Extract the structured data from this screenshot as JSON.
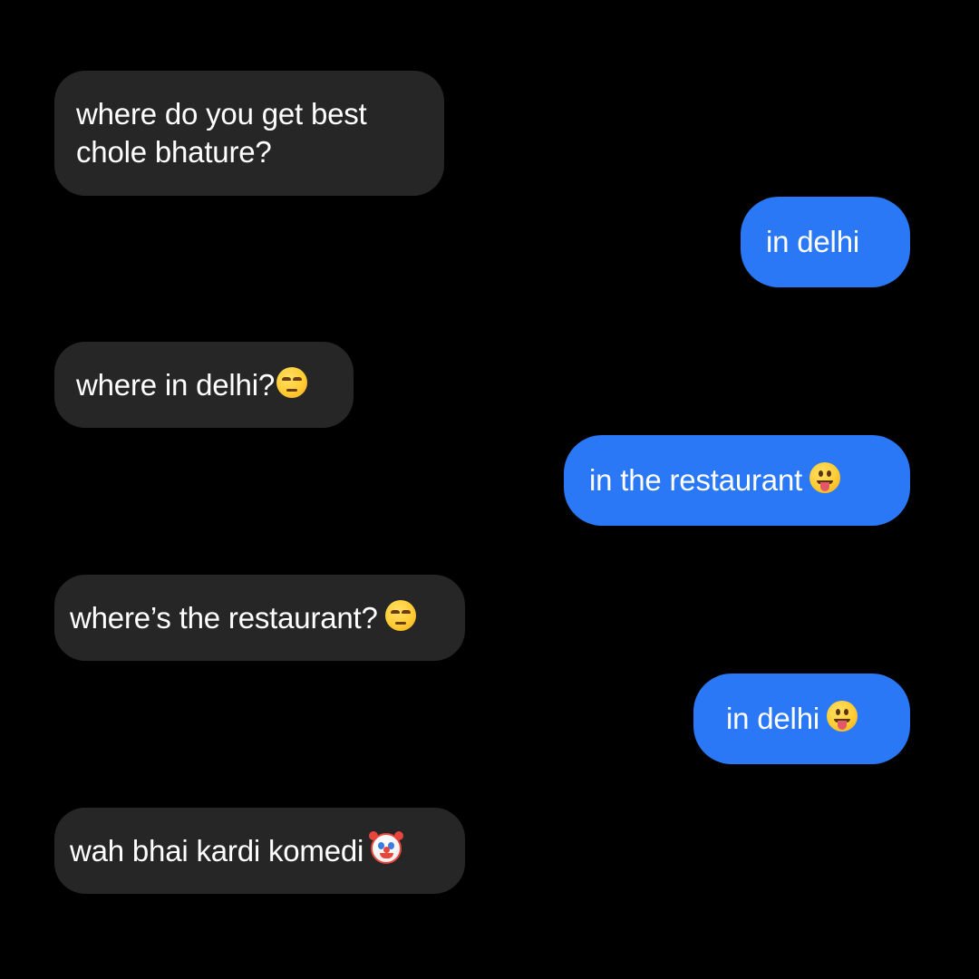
{
  "chat": {
    "messages": [
      {
        "direction": "received",
        "text": "where do you get best\nchole bhature?",
        "emoji": ""
      },
      {
        "direction": "sent",
        "text": "in delhi",
        "emoji": ""
      },
      {
        "direction": "received",
        "text": "where in delhi?",
        "emoji": "unamused-face-icon"
      },
      {
        "direction": "sent",
        "text": "in the restaurant ",
        "emoji": "face-with-tongue-icon"
      },
      {
        "direction": "received",
        "text": "where’s the restaurant? ",
        "emoji": "unamused-face-icon"
      },
      {
        "direction": "sent",
        "text": "in delhi ",
        "emoji": "face-with-tongue-icon"
      },
      {
        "direction": "received",
        "text": "wah bhai kardi komedi ",
        "emoji": "clown-face-icon"
      }
    ]
  },
  "colors": {
    "background": "#000000",
    "received_bubble": "#262626",
    "sent_bubble": "#2a78f5",
    "text": "#ffffff"
  }
}
